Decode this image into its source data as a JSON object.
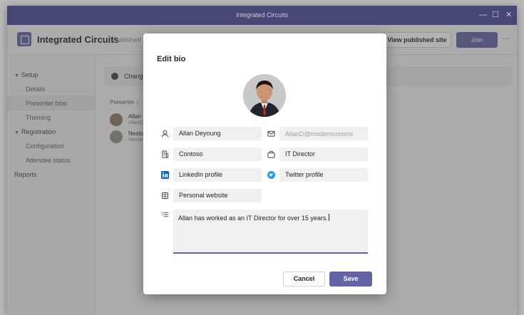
{
  "window": {
    "title": "Integrated Circuits",
    "controls": {
      "minimize": "—",
      "maximize": "☐",
      "close": "✕"
    }
  },
  "appbar": {
    "title": "Integrated Circuits",
    "status": "Published",
    "view_site_label": "View published site",
    "join_label": "Join",
    "more_label": "···"
  },
  "sidebar": {
    "items": [
      {
        "label": "Setup",
        "kind": "group"
      },
      {
        "label": "Details",
        "kind": "sub"
      },
      {
        "label": "Presenter bios",
        "kind": "sub",
        "selected": true
      },
      {
        "label": "Theming",
        "kind": "sub"
      },
      {
        "label": "Registration",
        "kind": "group"
      },
      {
        "label": "Configuration",
        "kind": "sub"
      },
      {
        "label": "Attendee status",
        "kind": "sub"
      },
      {
        "label": "Reports",
        "kind": "top"
      }
    ]
  },
  "content": {
    "banner_text": "Chang",
    "list_header": "Presenter ↑",
    "presenters": [
      {
        "name": "Allan",
        "email": "AllanD"
      },
      {
        "name": "Nesto",
        "email": "NestorW"
      }
    ]
  },
  "dialog": {
    "title": "Edit bio",
    "fields": {
      "name": {
        "value": "Allan Deyoung",
        "icon": "person-icon"
      },
      "email": {
        "placeholder": "AllanD@moderncomms",
        "icon": "mail-icon"
      },
      "company": {
        "value": "Contoso",
        "icon": "building-icon"
      },
      "job_title": {
        "value": "IT Director",
        "icon": "briefcase-icon"
      },
      "linkedin": {
        "value": "LinkedIn profile",
        "icon": "linkedin-icon"
      },
      "twitter": {
        "value": "Twitter profile",
        "icon": "twitter-icon"
      },
      "website": {
        "value": "Personal website",
        "icon": "globe-icon"
      },
      "bio": {
        "value": "Allan has worked as an IT Director for over 15 years.",
        "icon": "text-list-icon"
      }
    },
    "cancel_label": "Cancel",
    "save_label": "Save"
  },
  "colors": {
    "accent": "#6264a7",
    "titlebar": "#464775",
    "linkedin": "#0a66c2",
    "twitter": "#1d9bf0"
  }
}
